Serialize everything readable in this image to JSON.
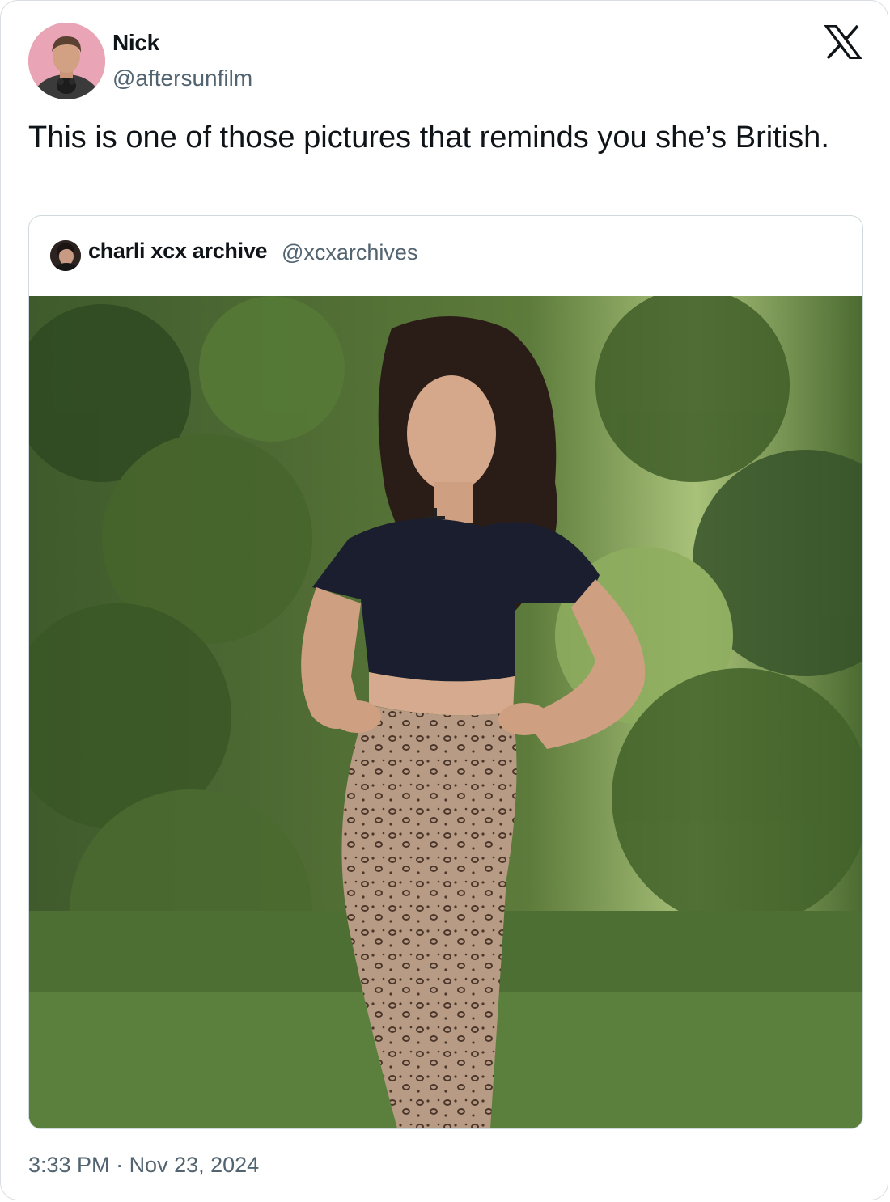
{
  "author": {
    "name": "Nick",
    "handle": "@aftersunfilm"
  },
  "logo": {
    "icon": "x-logo-icon"
  },
  "tweet": {
    "text": "This is one of those pictures that reminds you she’s British."
  },
  "quoted": {
    "name": "charli xcx archive",
    "handle": "@xcxarchives"
  },
  "meta": {
    "time": "3:33 PM",
    "separator": " · ",
    "date": "Nov 23, 2024"
  },
  "colors": {
    "text": "#0f1419",
    "secondary": "#536471",
    "border": "#cfd9de",
    "avatar_bg": "#e9a5b6"
  }
}
